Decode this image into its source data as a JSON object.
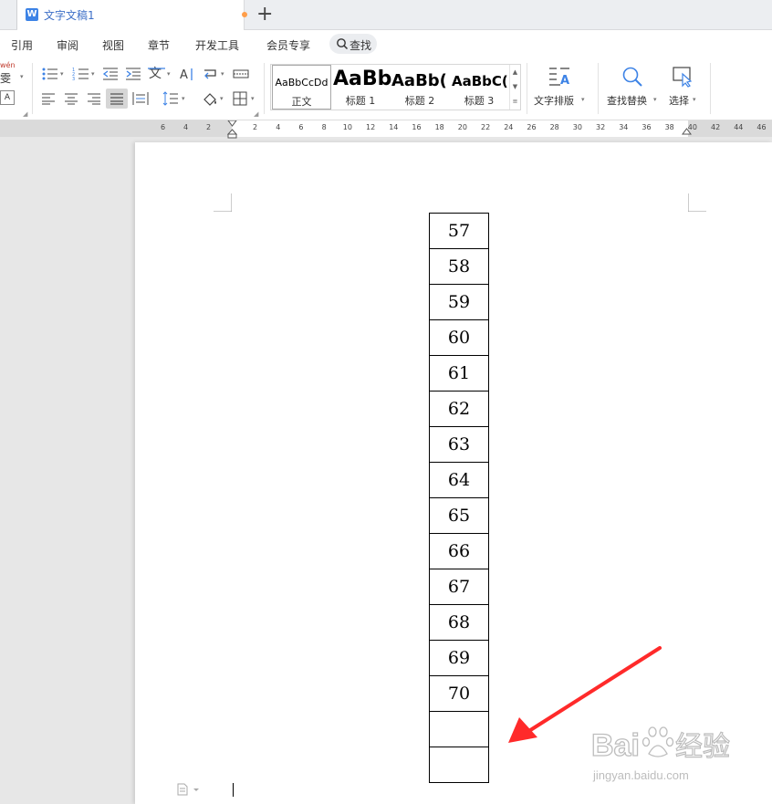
{
  "tab": {
    "title": "文字文稿1",
    "new_tab": "+"
  },
  "menu": {
    "items": [
      "引用",
      "审阅",
      "视图",
      "章节",
      "开发工具",
      "会员专享"
    ],
    "search": "查找"
  },
  "toolbar": {
    "pinyin_glyph": "wén",
    "pinyin_char": "雯",
    "styles": [
      {
        "preview": "AaBbCcDd",
        "name": "正文"
      },
      {
        "preview": "AaBb",
        "name": "标题 1"
      },
      {
        "preview": "AaBb(",
        "name": "标题 2"
      },
      {
        "preview": "AaBbC(",
        "name": "标题 3"
      }
    ],
    "text_layout": "文字排版",
    "find_replace": "查找替换",
    "select": "选择"
  },
  "ruler": {
    "left_numbers": [
      "6",
      "4",
      "2"
    ],
    "right_numbers": [
      "2",
      "4",
      "6",
      "8",
      "10",
      "12",
      "14",
      "16",
      "18",
      "20",
      "22",
      "24",
      "26",
      "28",
      "30",
      "32",
      "34",
      "36",
      "38",
      "40",
      "42",
      "44",
      "46"
    ]
  },
  "table": {
    "cells": [
      "57",
      "58",
      "59",
      "60",
      "61",
      "62",
      "63",
      "64",
      "65",
      "66",
      "67",
      "68",
      "69",
      "70",
      "",
      ""
    ]
  },
  "watermark": {
    "brand": "Bai",
    "brand2": "经验",
    "url": "jingyan.baidu.com"
  },
  "colors": {
    "accent": "#3d83e6",
    "arrow": "#ff2a2a",
    "modified_dot": "#ff9e4a"
  }
}
